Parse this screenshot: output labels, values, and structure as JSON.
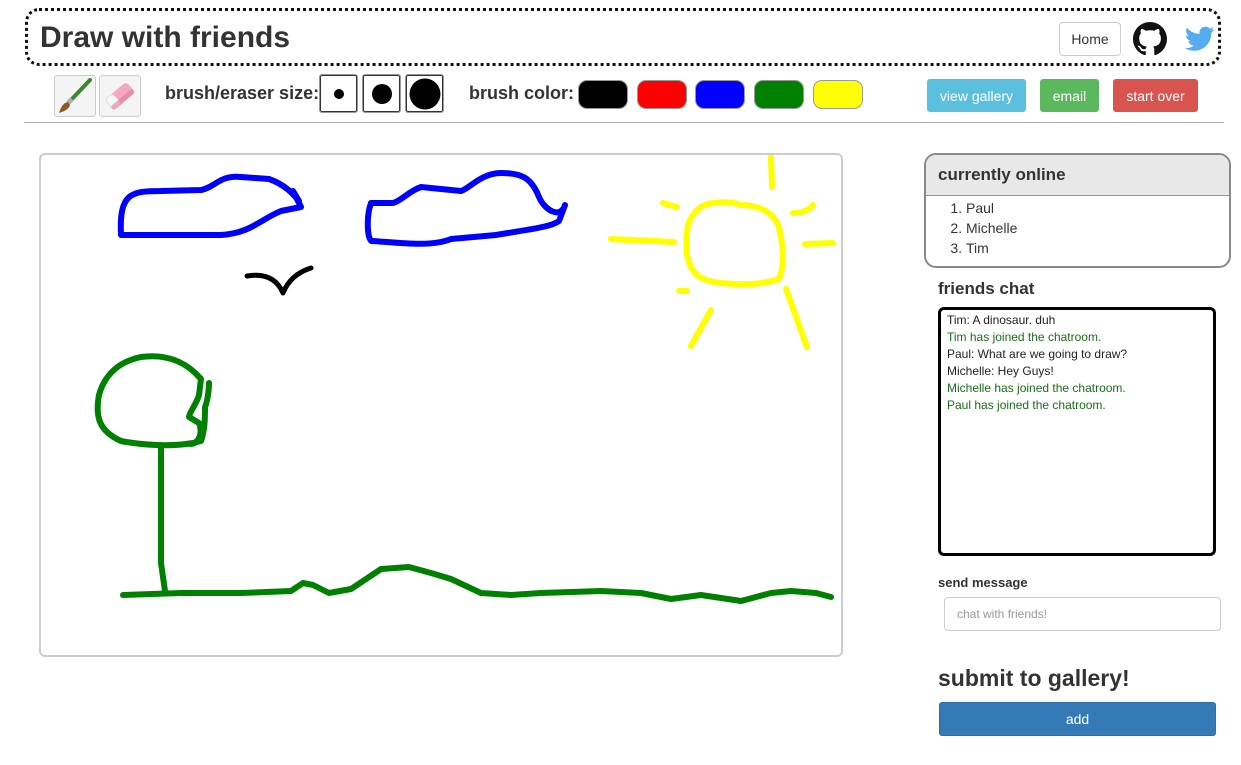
{
  "header": {
    "title": "Draw with friends",
    "home_label": "Home",
    "github_icon": "github-icon",
    "twitter_icon": "twitter-icon"
  },
  "toolbar": {
    "tools": [
      {
        "name": "brush",
        "icon": "brush-icon"
      },
      {
        "name": "eraser",
        "icon": "eraser-icon"
      }
    ],
    "size_label": "brush/eraser size:",
    "sizes": [
      "small",
      "medium",
      "large"
    ],
    "color_label": "brush color:",
    "colors": [
      "#000000",
      "#ff0000",
      "#0000ff",
      "#008000",
      "#ffff00"
    ],
    "view_gallery_label": "view gallery",
    "email_label": "email",
    "start_over_label": "start over",
    "view_gallery_color": "#5bc0de",
    "email_color": "#5cb85c",
    "start_over_color": "#d9534f"
  },
  "online": {
    "title": "currently online",
    "users": [
      "Paul",
      "Michelle",
      "Tim"
    ]
  },
  "chat": {
    "title": "friends chat",
    "messages": [
      {
        "text": "Tim: A dinosaur. duh",
        "type": "user"
      },
      {
        "text": "Tim has joined the chatroom.",
        "type": "system"
      },
      {
        "text": "Paul: What are we going to draw?",
        "type": "user"
      },
      {
        "text": "Michelle: Hey Guys!",
        "type": "user"
      },
      {
        "text": "Michelle has joined the chatroom.",
        "type": "system"
      },
      {
        "text": "Paul has joined the chatroom.",
        "type": "system"
      }
    ],
    "send_label": "send message",
    "input_placeholder": "chat with friends!"
  },
  "submit": {
    "title": "submit to gallery!",
    "add_label": "add"
  }
}
